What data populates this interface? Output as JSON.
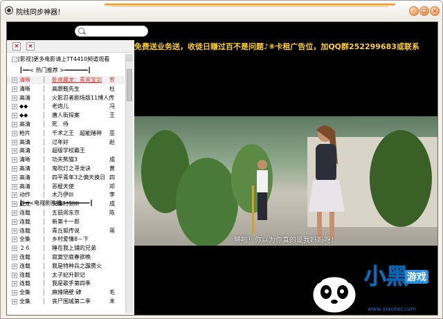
{
  "window": {
    "title": "院线同步神器！",
    "controls": {
      "min": "-",
      "max": "□",
      "close": "×"
    }
  },
  "toolbar": {
    "delete_label": "×",
    "close_label": "×"
  },
  "promo_text": "[影视]更多电影请上TT4410频道观看",
  "hot_section": "┃━━< 热门推荐 >━━━━━━━┃",
  "tv_section": "┃━━<电视剧热播>━━━━━━━┃",
  "movies": [
    {
      "tag": "清晰",
      "name": "卧虎藏龙：青冥宝剑",
      "editor": "贺",
      "selected": true
    },
    {
      "tag": "清晰",
      "name": "高跟鞋先生",
      "editor": "杜"
    },
    {
      "tag": "高清",
      "name": "火影忍者剧场版11博人传",
      "editor": ""
    },
    {
      "tag": "◆◆",
      "name": "老炮儿",
      "editor": "冯"
    },
    {
      "tag": "◆◆",
      "name": "唐人街探案",
      "editor": "王"
    },
    {
      "tag": "高清",
      "name": "死　侍",
      "editor": ""
    },
    {
      "tag": "枪片",
      "name": "千术之王　超能赌神",
      "editor": "亚"
    },
    {
      "tag": "高清",
      "name": "过年好",
      "editor": "赵"
    },
    {
      "tag": "高清",
      "name": "超级学校霸王",
      "editor": ""
    },
    {
      "tag": "清晰",
      "name": "功夫熊猫3",
      "editor": "成"
    },
    {
      "tag": "高清",
      "name": "鬼吹灯之寻龙诀",
      "editor": "黄"
    },
    {
      "tag": "高清",
      "name": "四平青年3之偏天换日",
      "editor": "四"
    },
    {
      "tag": "高清",
      "name": "恶棍天使",
      "editor": "邓"
    },
    {
      "tag": "动作",
      "name": "木乃伊III",
      "editor": "李"
    },
    {
      "tag": "成龙",
      "name": "尖峰时刻III",
      "editor": "成"
    }
  ],
  "series": [
    {
      "tag": "连载",
      "name": "五鼠闹东京",
      "editor": "陈"
    },
    {
      "tag": "连载",
      "name": "新第十一郎",
      "editor": ""
    },
    {
      "tag": "连载",
      "name": "青丘狐传说",
      "editor": "蒋"
    },
    {
      "tag": "全集",
      "name": "乡村爱情8－下",
      "editor": ""
    },
    {
      "tag": "２６",
      "name": "睡在我上铺的兄弟",
      "editor": ""
    },
    {
      "tag": "连载",
      "name": "寂寞空庭春欲晚",
      "editor": ""
    },
    {
      "tag": "连载",
      "name": "我是特种兵之霹雳火",
      "editor": ""
    },
    {
      "tag": "连载",
      "name": "太子妃升职记",
      "editor": ""
    },
    {
      "tag": "连载",
      "name": "我是歌手第四季",
      "editor": ""
    },
    {
      "tag": "全集",
      "name": "麻辣隔壁·肆",
      "editor": "毛"
    },
    {
      "tag": "全集",
      "name": "丧尸围城第二季",
      "editor": "末"
    }
  ],
  "marquee": "免费送业务送，收徒日赚过百不是问题♪⑧卡租广告位，加QQ群252299683或联系",
  "subtitle": "够啦！你以为你真的是我妈妈呀！",
  "logo": {
    "main": "小黑",
    "sub": "游戏",
    "url": "www.xiaohei.com"
  },
  "colors": {
    "marquee": "#ffd21f",
    "selected": "#d03030",
    "logo": "#2a90e0",
    "title_accent": "#f4a53a"
  }
}
